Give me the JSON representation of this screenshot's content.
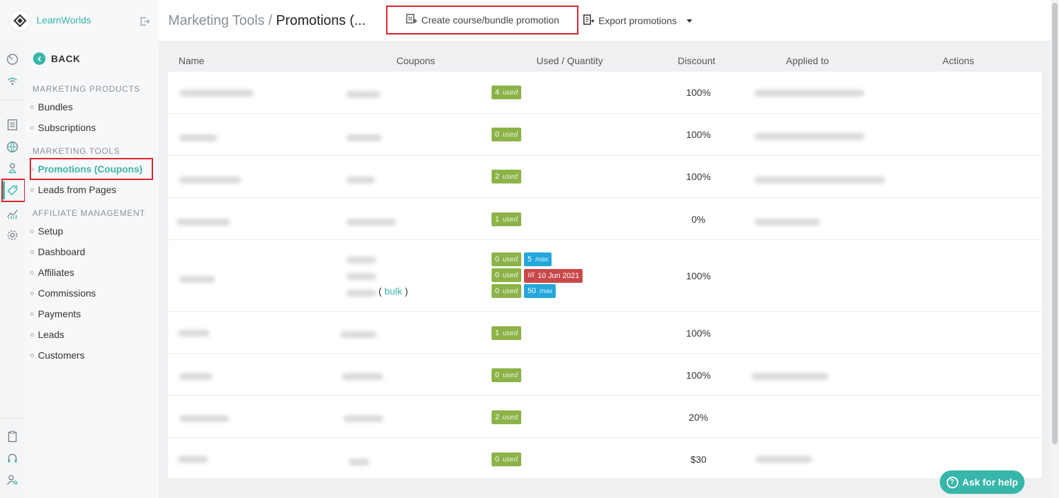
{
  "brand": {
    "name": "LearnWorlds",
    "accent": "#37b6a9"
  },
  "breadcrumb": {
    "parent": "Marketing Tools / ",
    "current": "Promotions (..."
  },
  "toolbar": {
    "create_label": "Create course/bundle promotion",
    "export_label": "Export promotions"
  },
  "nav": {
    "back_label": "BACK",
    "sections": {
      "marketing_products": "MARKETING PRODUCTS",
      "marketing_tools": "MARKETING TOOLS",
      "affiliate_management": "AFFILIATE MANAGEMENT"
    },
    "items": {
      "bundles": "Bundles",
      "subscriptions": "Subscriptions",
      "promotions": "Promotions (Coupons)",
      "leads_from_pages": "Leads from Pages",
      "setup": "Setup",
      "dashboard": "Dashboard",
      "affiliates": "Affiliates",
      "commissions": "Commissions",
      "payments": "Payments",
      "leads": "Leads",
      "customers": "Customers"
    }
  },
  "table": {
    "headers": {
      "name": "Name",
      "coupons": "Coupons",
      "used_quantity": "Used / Quantity",
      "discount": "Discount",
      "applied_to": "Applied to",
      "actions": "Actions"
    },
    "used_word": "used",
    "max_word": "max",
    "till_word": "till",
    "bulk_open": "( ",
    "bulk_link": "bulk",
    "bulk_close": " )",
    "rows": [
      {
        "used": "4",
        "discount": "100%"
      },
      {
        "used": "0",
        "discount": "100%"
      },
      {
        "used": "2",
        "discount": "100%"
      },
      {
        "used": "1",
        "discount": "0%"
      },
      {
        "used_a": "0",
        "max_a": "5",
        "used_b": "0",
        "till_b": "10 Jun 2021",
        "used_c": "0",
        "max_c": "50",
        "discount": "100%"
      },
      {
        "used": "1",
        "discount": "100%"
      },
      {
        "used": "0",
        "discount": "100%"
      },
      {
        "used": "2",
        "discount": "20%"
      },
      {
        "used": "0",
        "discount": "$30"
      }
    ]
  },
  "help": {
    "label": "Ask for help"
  },
  "colors": {
    "used_badge": "#8bb347",
    "max_badge": "#23a7dc",
    "till_badge": "#c9484a",
    "highlight": "#d9222a"
  }
}
